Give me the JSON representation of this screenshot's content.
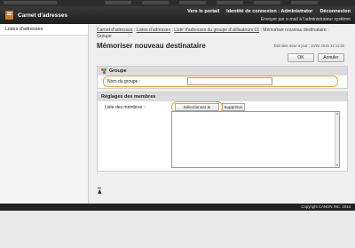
{
  "header": {
    "app_title": "Carnet d'adresses",
    "nav": {
      "portal": "Vers le portail",
      "login_label": "Identité de connexion : Administrator",
      "logout": "Déconnexion"
    },
    "email_link": "Envoyer par e-mail à l'administrateur système"
  },
  "sidebar": {
    "items": [
      {
        "label": "Listes d'adresses"
      }
    ]
  },
  "main": {
    "breadcrumb": {
      "line1_links": [
        "Carnet d'adresses",
        "Listes d'adresses",
        "Liste d'adresses du groupe d'utilisateurs 01"
      ],
      "line1_tail": "Mémoriser nouveau destinataire :",
      "line2": "Groupe",
      "separator": " : "
    },
    "page_title": "Mémoriser nouveau destinataire",
    "last_update": "Dernière mise à jour : 10/04 2015 12:11:52",
    "buttons": {
      "ok": "OK",
      "cancel": "Annuler"
    },
    "group_section": {
      "title": "Groupe",
      "name_label": "Nom du groupe :",
      "name_value": ""
    },
    "members_section": {
      "title": "Réglages des membres",
      "list_label": "Liste des membres :",
      "select_button": "Sélectionner le destinataire...",
      "delete_button": "Supprimer"
    },
    "back_to_top_icon": "arrow-up-icon"
  },
  "footer": {
    "copyright": "Copyright CANON INC. 2015"
  },
  "colors": {
    "header_bg": "#1e1e1e",
    "highlight": "#f0a030",
    "brand_icon": "#d4782a"
  }
}
